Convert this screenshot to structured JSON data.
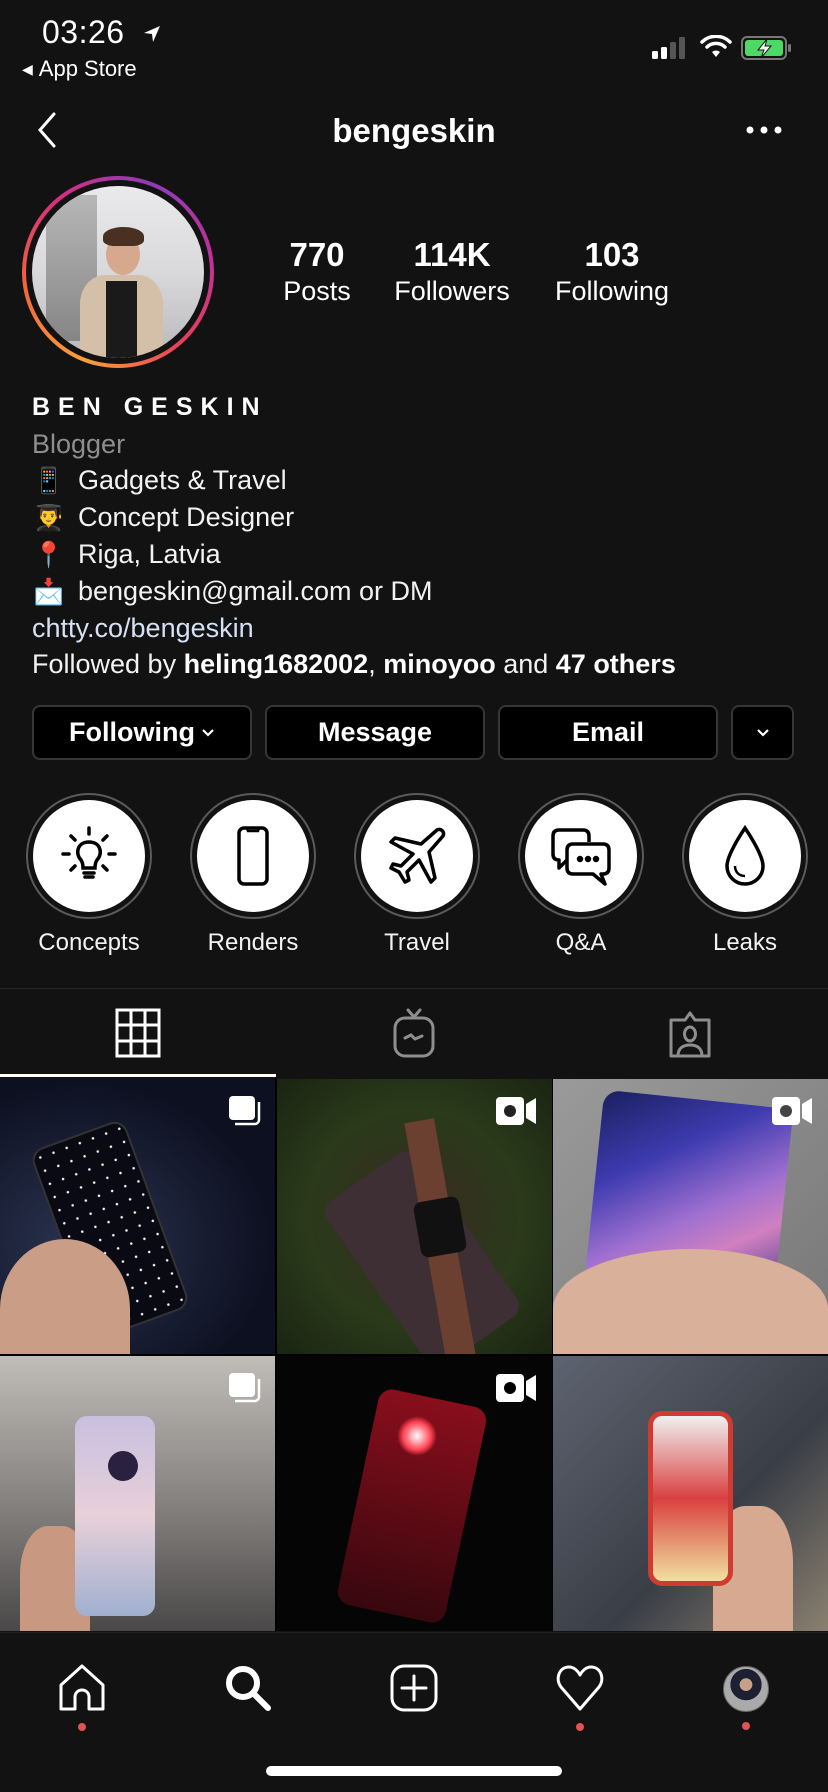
{
  "status_bar": {
    "time": "03:26",
    "back_app": "App Store",
    "icons": [
      "location-arrow-icon",
      "signal-icon",
      "wifi-icon",
      "battery-charging-icon"
    ],
    "signal_bars_active": 2,
    "signal_bars_total": 4,
    "battery_color": "#4cd964"
  },
  "header": {
    "username": "bengeskin",
    "back_icon": "chevron-left-icon",
    "more_icon": "more-horizontal-icon"
  },
  "profile": {
    "avatar_ring_colors": [
      "#f9a13a",
      "#d82d7e",
      "#8f3bb8"
    ],
    "stats": [
      {
        "value": "770",
        "label": "Posts"
      },
      {
        "value": "114K",
        "label": "Followers"
      },
      {
        "value": "103",
        "label": "Following"
      }
    ]
  },
  "bio": {
    "full_name": "BEN GESKIN",
    "category": "Blogger",
    "lines": [
      {
        "emoji": "📱",
        "text": "Gadgets & Travel"
      },
      {
        "emoji": "👨‍🎓",
        "text": "Concept Designer"
      },
      {
        "emoji": "📍",
        "text": "Riga, Latvia"
      },
      {
        "emoji": "📩",
        "text": "bengeskin@gmail.com or DM"
      }
    ],
    "link": "chtty.co/bengeskin",
    "followed_by": {
      "prefix": "Followed by ",
      "user1": "heling1682002",
      "separator": ", ",
      "user2": "minoyoo",
      "middle": " and ",
      "others": "47 others"
    }
  },
  "actions": {
    "following": "Following",
    "message": "Message",
    "email": "Email",
    "more_icon": "chevron-down-icon"
  },
  "highlights": [
    {
      "label": "Concepts",
      "icon": "lightbulb-icon"
    },
    {
      "label": "Renders",
      "icon": "smartphone-icon"
    },
    {
      "label": "Travel",
      "icon": "airplane-icon"
    },
    {
      "label": "Q&A",
      "icon": "chat-bubbles-icon"
    },
    {
      "label": "Leaks",
      "icon": "droplet-icon"
    }
  ],
  "tabs": [
    {
      "name": "grid",
      "icon": "grid-icon",
      "active": true
    },
    {
      "name": "igtv",
      "icon": "igtv-icon",
      "active": false
    },
    {
      "name": "tagged",
      "icon": "tagged-person-icon",
      "active": false
    }
  ],
  "posts": [
    {
      "type": "carousel",
      "badge_icon": "carousel-icon",
      "subject": "phone with space wallpaper"
    },
    {
      "type": "video",
      "badge_icon": "video-icon",
      "subject": "phone and watch on moss"
    },
    {
      "type": "video",
      "badge_icon": "video-icon",
      "subject": "phone with purple wallpaper"
    },
    {
      "type": "carousel",
      "badge_icon": "carousel-icon",
      "subject": "iridescent phone back"
    },
    {
      "type": "video",
      "badge_icon": "video-icon",
      "subject": "red phone in the dark"
    },
    {
      "type": "photo",
      "badge_icon": "",
      "subject": "phone in red case"
    }
  ],
  "bottom_nav": [
    {
      "name": "home",
      "icon": "home-icon",
      "notification": true
    },
    {
      "name": "search",
      "icon": "search-icon",
      "notification": false
    },
    {
      "name": "new-post",
      "icon": "add-post-icon",
      "notification": false
    },
    {
      "name": "activity",
      "icon": "heart-icon",
      "notification": true
    },
    {
      "name": "profile",
      "icon": "profile-avatar-icon",
      "notification": true
    }
  ],
  "colors": {
    "background": "#121212",
    "notification_dot": "#e05454",
    "link": "#d6e1f5",
    "secondary_text": "#8e8e8e"
  }
}
